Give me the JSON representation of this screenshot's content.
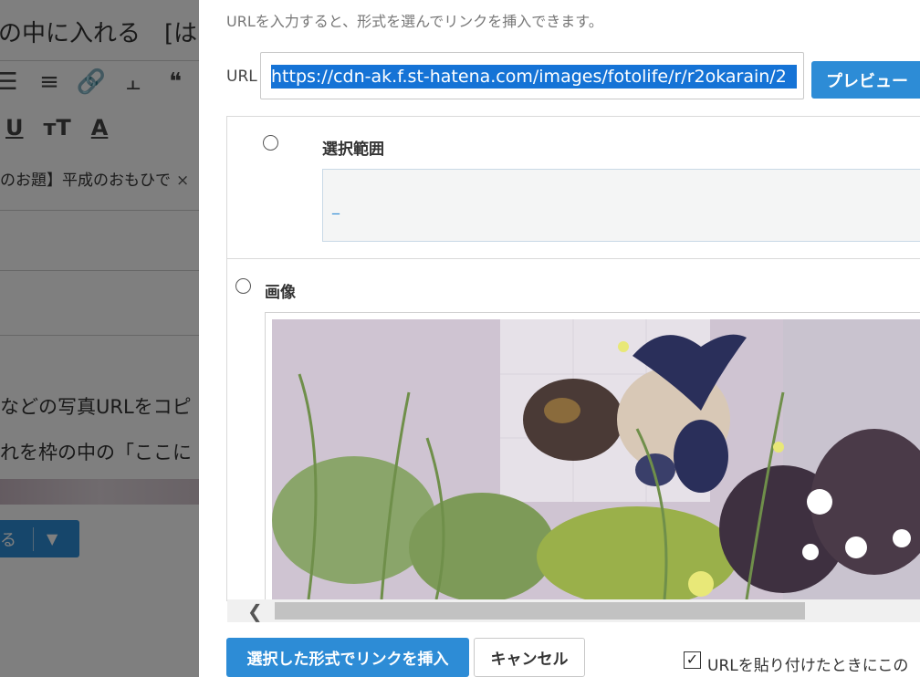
{
  "background": {
    "title": "の中に入れる　[はて",
    "tag": "のお題】平成のおもひで",
    "tag_close": "×",
    "paragraph1": "などの写真URLをコピ",
    "paragraph2": "れを枠の中の「ここに",
    "publish_label": "る"
  },
  "dialog": {
    "description": "URLを入力すると、形式を選んでリンクを挿入できます。",
    "url_label": "URL",
    "url_value": "https://cdn-ak.f.st-hatena.com/images/fotolife/r/r2okarain/2",
    "preview_button": "プレビュー",
    "option_selection_label": "選択範囲",
    "selection_cursor": "_",
    "option_image_label": "画像",
    "insert_button": "選択した形式でリンクを挿入",
    "cancel_button": "キャンセル",
    "checkbox_label": "URLを貼り付けたときにこの",
    "checkbox_checked": true
  },
  "colors": {
    "accent": "#2d8cd6",
    "selection": "#1573d6"
  }
}
